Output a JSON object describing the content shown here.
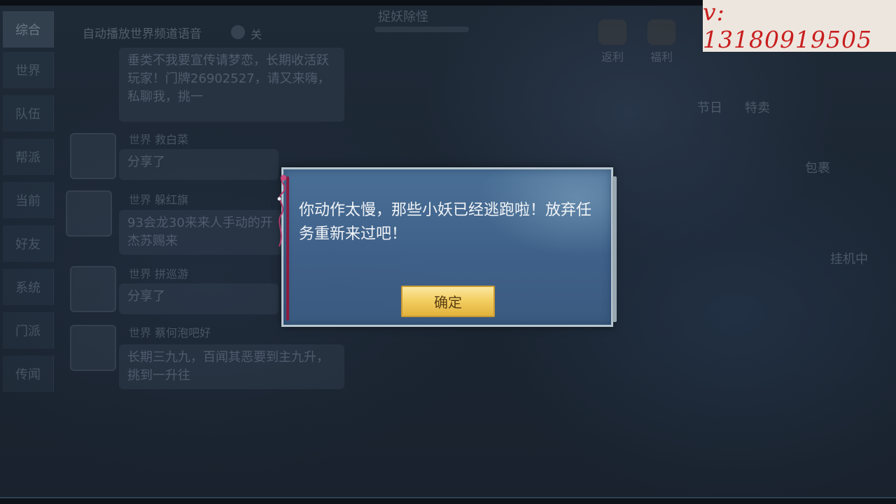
{
  "dialog": {
    "message": "你动作太慢，那些小妖已经逃跑啦！放弃任务重新来过吧！",
    "confirm_label": "确定"
  },
  "watermark": {
    "text": "v: 13180919505"
  },
  "background": {
    "chat_header": "自动播放世界频道语音",
    "chat_toggle_label": "关",
    "side_tabs": [
      "综合",
      "世界",
      "队伍",
      "帮派",
      "当前",
      "好友",
      "系统",
      "门派",
      "传闻"
    ],
    "task_title": "捉妖除怪",
    "top_icons": [
      "返利",
      "福利"
    ],
    "right_labels": [
      "节日",
      "特卖",
      "包裹",
      "挂机中"
    ],
    "channel_label": "世界",
    "share_label": "分享了",
    "senders": [
      "救白菜",
      "躲红旗",
      "拼巡游",
      "蔡何泡吧好"
    ],
    "messages": [
      "垂类不我要宣传请梦恋，长期收活跃玩家！门牌26902527，请又来嗨，私聊我，挑一",
      "93会龙30来来人手动的开杰苏赐来",
      "长期三九九，百闻其恶要到主九升，挑到一升往"
    ]
  }
}
